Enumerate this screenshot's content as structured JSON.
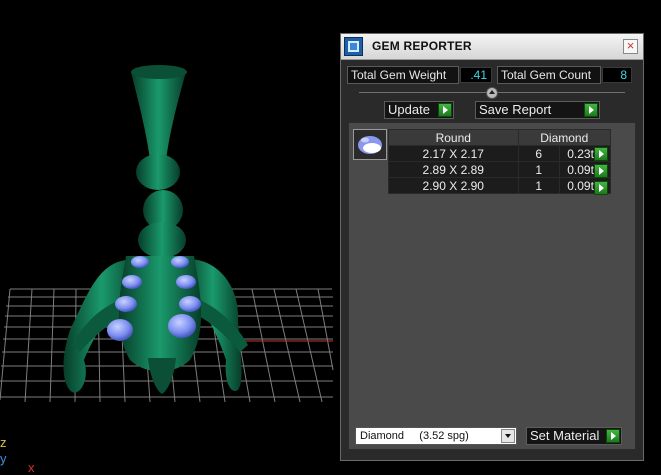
{
  "panel": {
    "title": "GEM REPORTER",
    "close_label": "×",
    "total_weight_label": "Total Gem Weight",
    "total_weight_value": ".41",
    "total_count_label": "Total Gem Count",
    "total_count_value": "8",
    "update_label": "Update",
    "save_report_label": "Save Report",
    "table": {
      "headers": [
        "Round",
        "Diamond"
      ],
      "rows": [
        {
          "size": "2.17 X 2.17",
          "count": "6",
          "weight": "0.23tw"
        },
        {
          "size": "2.89 X 2.89",
          "count": "1",
          "weight": "0.09tw"
        },
        {
          "size": "2.90 X 2.90",
          "count": "1",
          "weight": "0.09tw"
        }
      ]
    },
    "material_selected": "Diamond     (3.52 spg)",
    "set_material_label": "Set Material"
  },
  "viewport": {
    "axis_z": "z",
    "axis_y": "y",
    "axis_x": "x"
  },
  "colors": {
    "model_green": "#0d6b4a",
    "gem_blue": "#8a9cf0",
    "value_cyan": "#3fd7e8",
    "go_green": "#2e9e2e"
  },
  "icons": [
    "app-icon",
    "close-icon",
    "collapse-icon",
    "go-arrow-icon",
    "gem-thumbnail-icon",
    "dropdown-arrow-icon"
  ]
}
